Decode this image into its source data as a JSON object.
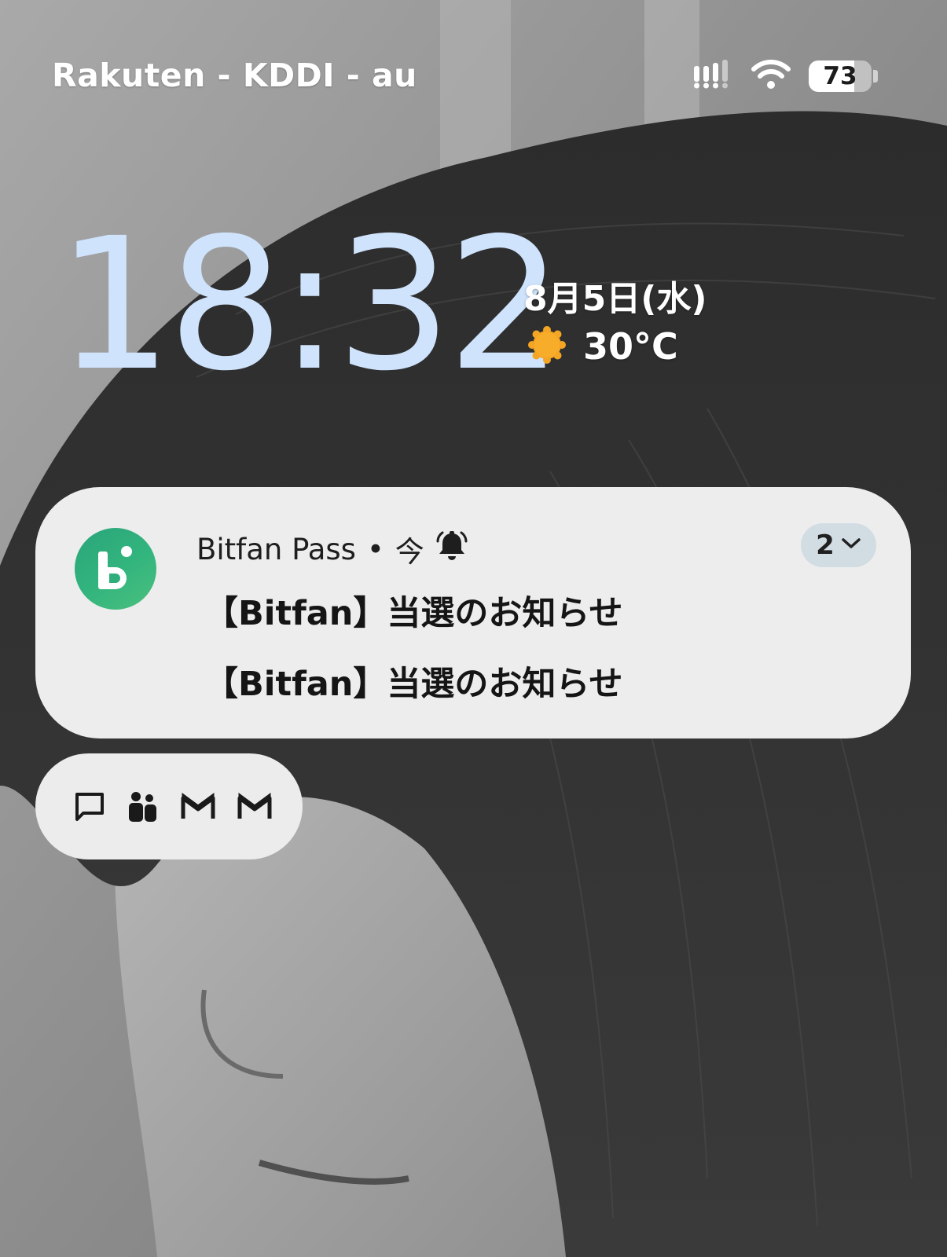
{
  "status_bar": {
    "carrier": "Rakuten - KDDI - au",
    "battery_level": "73",
    "battery_fraction": 0.73
  },
  "lock_screen": {
    "time": "18:32",
    "date": "8月5日(水)",
    "temperature": "30°C",
    "weather_icon": "sun-icon"
  },
  "notification": {
    "app_name": "Bitfan Pass",
    "separator": "•",
    "time": "今",
    "bell_icon": "bell-ringing-icon",
    "count": "2",
    "lines": [
      "【Bitfan】当選のお知らせ",
      "【Bitfan】当選のお知らせ"
    ],
    "colors": {
      "app_icon": "#2fae7c",
      "card": "#ededed",
      "count_pill": "#d2dce3"
    }
  },
  "notification_icons": [
    "chat-bubble-icon",
    "people-icon",
    "gmail-icon",
    "gmail-icon"
  ],
  "colors": {
    "clock": "#cfe3fc",
    "sun": "#f5a524"
  }
}
